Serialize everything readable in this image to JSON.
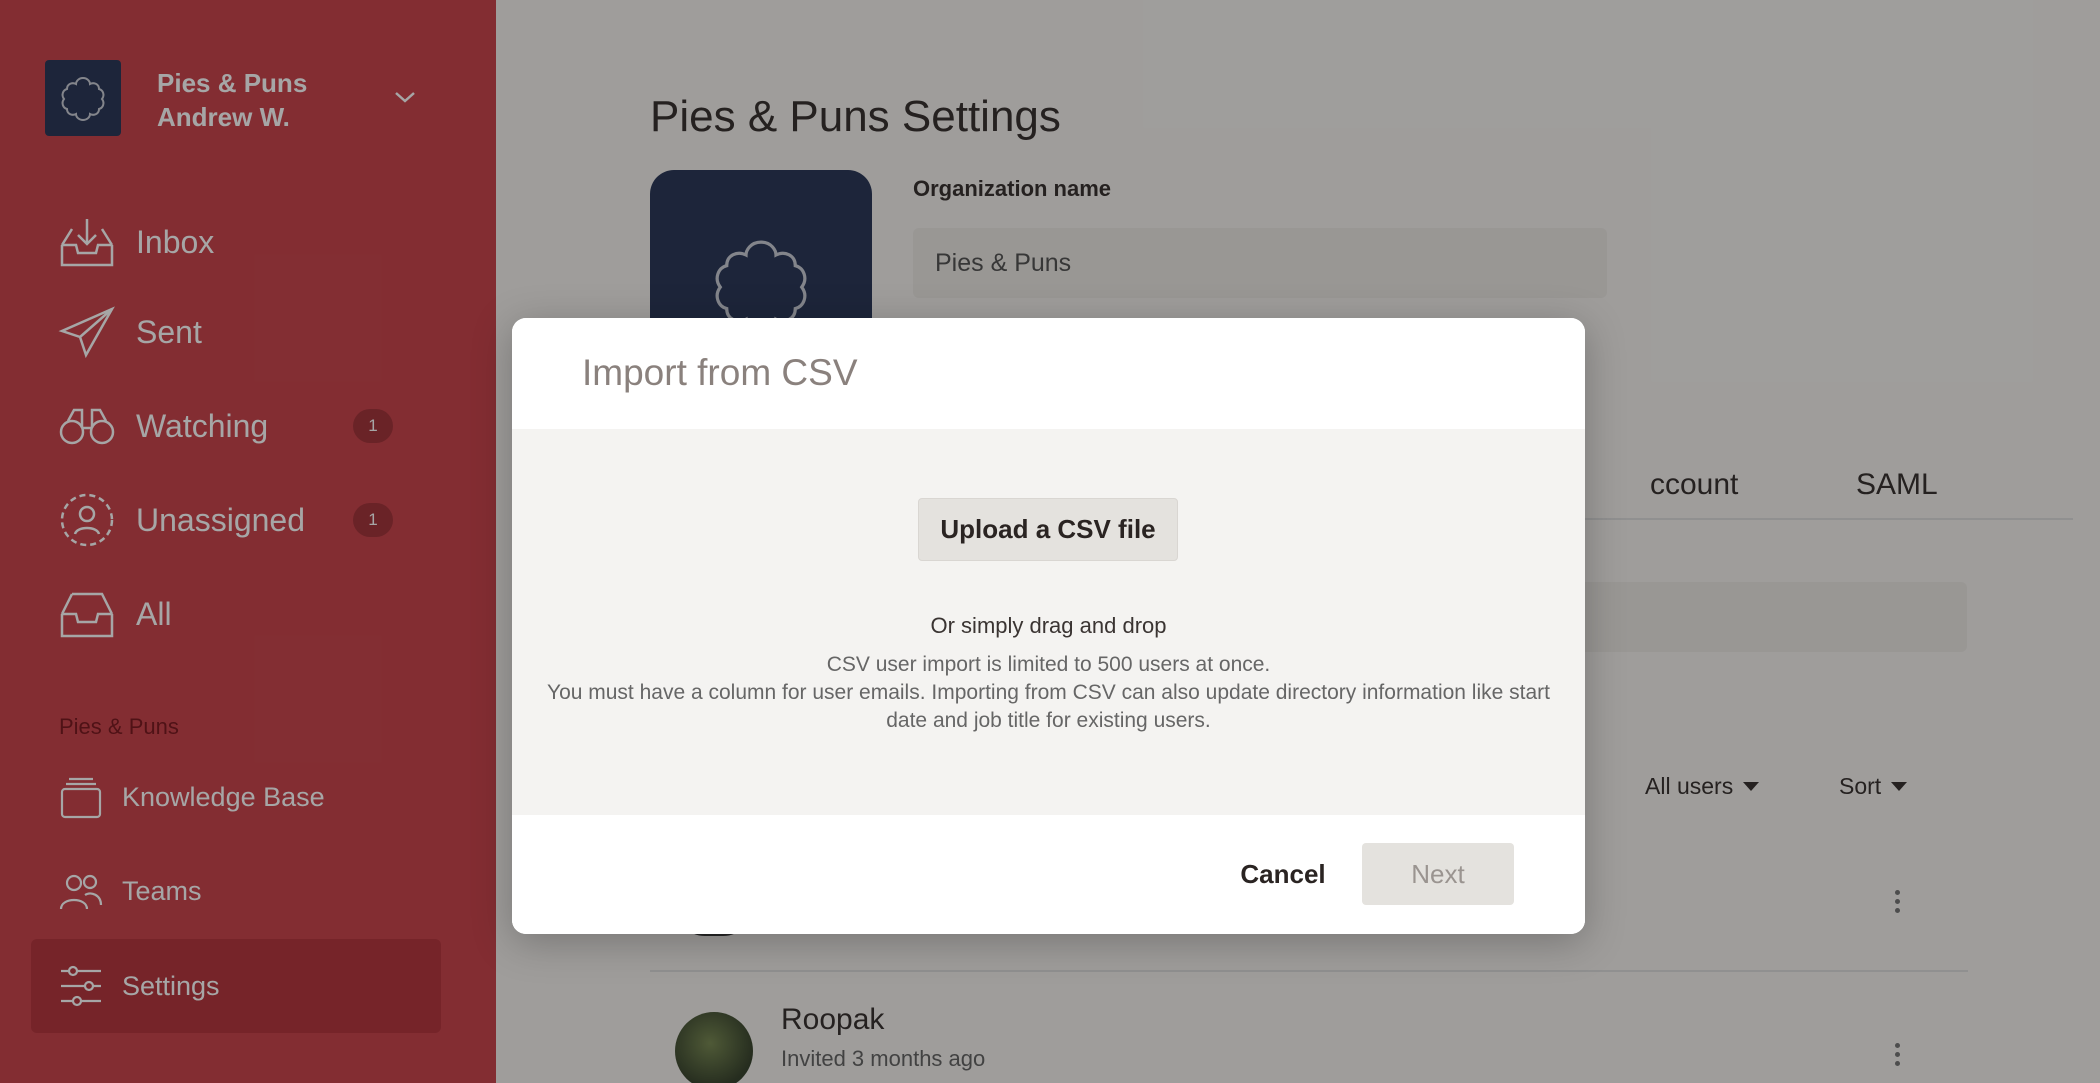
{
  "org": {
    "name": "Pies & Puns",
    "user": "Andrew W.",
    "logo_icon": "flower-icon",
    "chevron_icon": "chevron-down-icon"
  },
  "nav": {
    "items": [
      {
        "label": "Inbox",
        "icon": "inbox-download-icon"
      },
      {
        "label": "Sent",
        "icon": "paper-plane-icon"
      },
      {
        "label": "Watching",
        "icon": "binoculars-icon",
        "badge": "1"
      },
      {
        "label": "Unassigned",
        "icon": "user-circle-dashed-icon",
        "badge": "1"
      },
      {
        "label": "All",
        "icon": "tray-icon"
      }
    ],
    "section_label": "Pies & Puns",
    "sub_items": [
      {
        "label": "Knowledge Base",
        "icon": "stack-icon"
      },
      {
        "label": "Teams",
        "icon": "people-icon"
      },
      {
        "label": "Settings",
        "icon": "sliders-icon",
        "active": true
      }
    ]
  },
  "main": {
    "title": "Pies & Puns Settings",
    "org_name_label": "Organization name",
    "org_name_value": "Pies & Puns",
    "tabs": [
      "ccount",
      "SAML"
    ],
    "filters": {
      "users": "All users",
      "sort": "Sort"
    },
    "member": {
      "name": "Roopak",
      "status": "Invited 3 months ago"
    }
  },
  "modal": {
    "title": "Import from CSV",
    "upload_label": "Upload a CSV file",
    "drag_text": "Or simply drag and drop",
    "info_line1": "CSV user import is limited to 500 users at once.",
    "info_line2": "You must have a column for user emails. Importing from CSV can also update directory information like start date and job title for existing users.",
    "cancel_label": "Cancel",
    "next_label": "Next"
  },
  "colors": {
    "sidebar": "#c9464e",
    "sidebar_active": "#b53840",
    "logo_bg": "#2d3a5a",
    "modal_body": "#f4f3f1"
  }
}
